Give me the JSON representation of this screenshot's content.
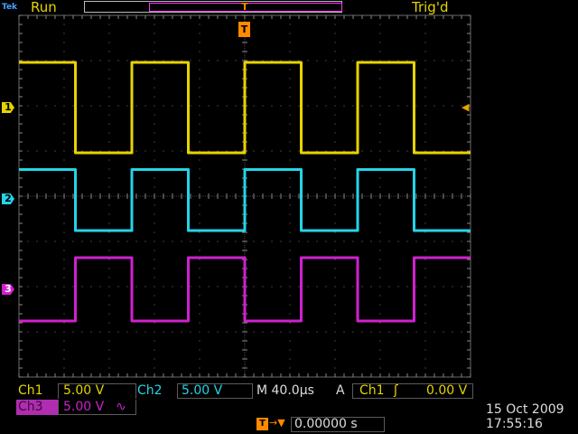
{
  "status": {
    "run_label": "Run",
    "trig_state": "Trig'd",
    "run_icon": "tek-logo-icon"
  },
  "markers": {
    "ch1": "1",
    "ch2": "2",
    "ch3": "3",
    "trigger_position": "T"
  },
  "channels": [
    {
      "name": "Ch1",
      "scale": "5.00 V",
      "color": "#e6d400"
    },
    {
      "name": "Ch2",
      "scale": "5.00 V",
      "color": "#25d4e6"
    },
    {
      "name": "Ch3",
      "scale": "5.00 V",
      "coupling": "∿",
      "color": "#d020d0"
    }
  ],
  "timebase": {
    "label": "M 40.0µs"
  },
  "trigger": {
    "mode": "A",
    "source": "Ch1",
    "slope": "ʃ",
    "level": "0.00 V",
    "time": "0.00000 s"
  },
  "datetime": {
    "date": "15 Oct  2009",
    "time": "17:55:16"
  },
  "chart_data": {
    "type": "line",
    "x": [
      0,
      1.25,
      2.5,
      3.75,
      5,
      6.25,
      7.5,
      8.75,
      10
    ],
    "series": [
      {
        "name": "Ch1",
        "color": "#e6d400",
        "edges": [
          1.25,
          2.5,
          3.75,
          5,
          6.25,
          7.5,
          8.75
        ],
        "high": 1.0,
        "low": -1.0,
        "start_high": true
      },
      {
        "name": "Ch2",
        "color": "#25d4e6",
        "edges": [
          1.25,
          2.5,
          3.75,
          5,
          6.25,
          7.5,
          8.75
        ],
        "high": 0.65,
        "low": -0.7,
        "start_high": true
      },
      {
        "name": "Ch3",
        "color": "#d020d0",
        "edges": [
          1.25,
          2.5,
          3.75,
          5,
          6.25,
          7.5,
          8.75
        ],
        "high": 0.7,
        "low": -0.7,
        "start_high": false
      }
    ],
    "xlim": [
      0,
      10
    ],
    "divisions_x": 10,
    "divisions_y": 8,
    "grid": true
  }
}
